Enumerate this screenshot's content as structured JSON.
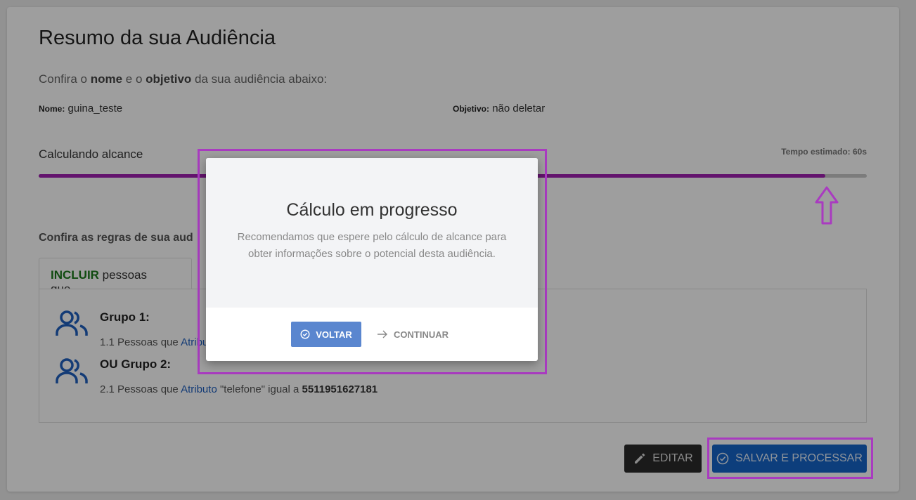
{
  "page": {
    "title": "Resumo da sua Audiência",
    "subtitle": {
      "p1": "Confira o ",
      "b1": "nome",
      "p2": " e o ",
      "b2": "objetivo",
      "p3": " da sua audiência abaixo:"
    },
    "nome": {
      "label": "Nome:",
      "value": "guina_teste"
    },
    "objetivo": {
      "label": "Objetivo:",
      "value": "não deletar"
    }
  },
  "progress": {
    "title": "Calculando alcance",
    "estimate": "Tempo estimado: 60s",
    "percent": 95
  },
  "rules": {
    "title": "Confira as regras de sua aud",
    "tab": {
      "highlight": "INCLUIR",
      "rest": " pessoas que..."
    },
    "groups": [
      {
        "title": "Grupo 1:",
        "prefix": "1.1 Pessoas que ",
        "attr": "Atribu"
      },
      {
        "title": "OU Grupo 2:",
        "prefix": "2.1 Pessoas que ",
        "attr": "Atributo",
        "mid": " \"telefone\" igual a ",
        "value": "5511951627181"
      }
    ]
  },
  "actions": {
    "edit": "EDITAR",
    "save": "SALVAR E PROCESSAR"
  },
  "modal": {
    "title": "Cálculo em progresso",
    "text": "Recomendamos que espere pelo cálculo de alcance para obter informações sobre o potencial desta audiência.",
    "back": "VOLTAR",
    "continue": "CONTINUAR"
  },
  "colors": {
    "accent": "#1565c8",
    "progress": "#a020b0",
    "highlight": "#a93bc0",
    "include": "#1b7a1b"
  }
}
